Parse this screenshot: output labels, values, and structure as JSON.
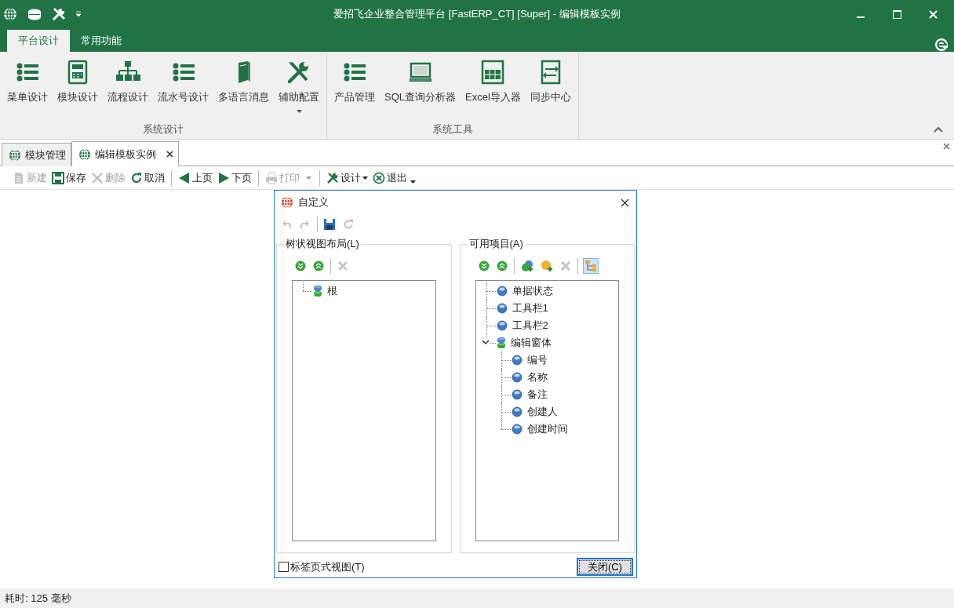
{
  "window": {
    "title": "爱招飞企业整合管理平台 [FastERP_CT] [Super] - 编辑模板实例"
  },
  "ribbon": {
    "tabs": [
      {
        "label": "平台设计",
        "selected": true
      },
      {
        "label": "常用功能",
        "selected": false
      }
    ],
    "groups": [
      {
        "label": "系统设计",
        "buttons": [
          {
            "label": "菜单设计",
            "dropdown": false
          },
          {
            "label": "模块设计",
            "dropdown": false
          },
          {
            "label": "流程设计",
            "dropdown": false
          },
          {
            "label": "流水号设计",
            "dropdown": false
          },
          {
            "label": "多语言消息",
            "dropdown": false
          },
          {
            "label": "辅助配置",
            "dropdown": true
          }
        ]
      },
      {
        "label": "系统工具",
        "buttons": [
          {
            "label": "产品管理",
            "dropdown": false
          },
          {
            "label": "SQL查询分析器",
            "dropdown": false
          },
          {
            "label": "Excel导入器",
            "dropdown": false
          },
          {
            "label": "同步中心",
            "dropdown": false
          }
        ]
      }
    ]
  },
  "doc_tabs": [
    {
      "label": "模块管理",
      "selected": false,
      "closable": false
    },
    {
      "label": "编辑模板实例",
      "selected": true,
      "closable": true
    }
  ],
  "toolbar": [
    {
      "kind": "button",
      "label": "新建",
      "disabled": true
    },
    {
      "kind": "button",
      "label": "保存",
      "disabled": false
    },
    {
      "kind": "button",
      "label": "删除",
      "disabled": true
    },
    {
      "kind": "button",
      "label": "取消",
      "disabled": false
    },
    {
      "kind": "separator"
    },
    {
      "kind": "button",
      "label": "上页",
      "disabled": false
    },
    {
      "kind": "button",
      "label": "下页",
      "disabled": false
    },
    {
      "kind": "separator"
    },
    {
      "kind": "split",
      "label": "打印",
      "disabled": true
    },
    {
      "kind": "separator"
    },
    {
      "kind": "dropdown",
      "label": "设计",
      "disabled": false
    },
    {
      "kind": "button",
      "label": "退出",
      "disabled": false
    }
  ],
  "dialog": {
    "title": "自定义",
    "tools": [
      {
        "disabled": true
      },
      {
        "disabled": true
      },
      {
        "disabled": false
      },
      {
        "disabled": true
      }
    ],
    "panels": [
      {
        "title": "树状视图布局(L)",
        "tools": [
          {
            "disabled": false,
            "selected": false
          },
          {
            "disabled": false,
            "selected": false
          },
          {
            "disabled": true,
            "selected": false
          }
        ],
        "tree": [
          {
            "label": "根",
            "kind": "group",
            "expanded": false
          }
        ]
      },
      {
        "title": "可用项目(A)",
        "tools": [
          {
            "disabled": false,
            "selected": false
          },
          {
            "disabled": false,
            "selected": false
          },
          {
            "disabled": false,
            "selected": false
          },
          {
            "disabled": false,
            "selected": false
          },
          {
            "disabled": true,
            "selected": false
          },
          {
            "disabled": false,
            "selected": true
          }
        ],
        "tree": [
          {
            "label": "单据状态",
            "kind": "item",
            "expanded": false
          },
          {
            "label": "工具栏1",
            "kind": "item",
            "expanded": false
          },
          {
            "label": "工具栏2",
            "kind": "item",
            "expanded": false
          },
          {
            "label": "编辑窗体",
            "kind": "group",
            "expanded": true,
            "children": [
              {
                "label": "编号",
                "kind": "item",
                "expanded": false
              },
              {
                "label": "名称",
                "kind": "item",
                "expanded": false
              },
              {
                "label": "备注",
                "kind": "item",
                "expanded": false
              },
              {
                "label": "创建人",
                "kind": "item",
                "expanded": false
              },
              {
                "label": "创建时间",
                "kind": "item",
                "expanded": false
              }
            ]
          }
        ]
      }
    ],
    "checkbox": {
      "label": "标签页式视图(T)",
      "checked": false
    },
    "button": "关闭(C)"
  },
  "status_bar": "耗时: 125 毫秒"
}
